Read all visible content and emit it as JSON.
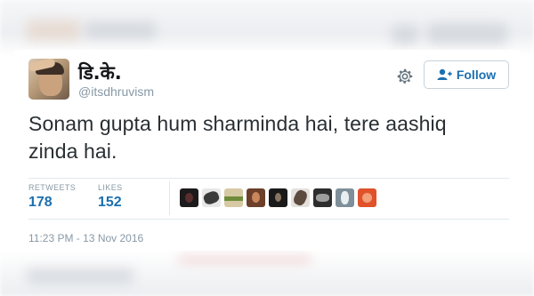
{
  "tweet": {
    "display_name": "डि.के.",
    "handle": "@itsdhruvism",
    "follow_label": "Follow",
    "text_line1": "Sonam gupta hum sharminda hai, tere aashiq",
    "text_line2": "zinda hai.",
    "stats": {
      "retweets_label": "RETWEETS",
      "retweets_value": "178",
      "likes_label": "LIKES",
      "likes_value": "152"
    },
    "timestamp": "11:23 PM - 13 Nov 2016"
  },
  "icons": {
    "settings": "gear-icon",
    "follow": "add-user-icon"
  },
  "colors": {
    "accent": "#1b6fb0",
    "muted": "#8899a6",
    "text": "#292f33",
    "border": "#e1e8ed"
  }
}
